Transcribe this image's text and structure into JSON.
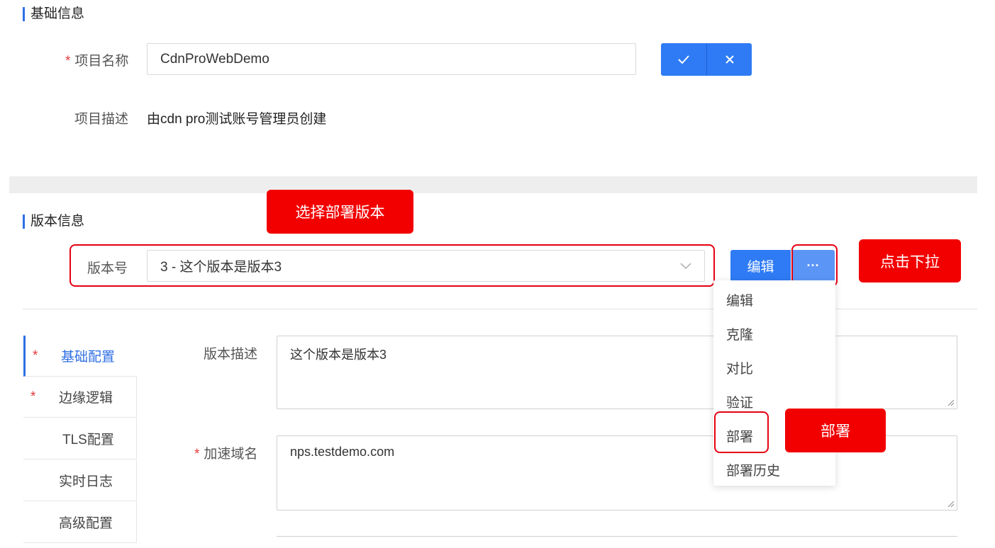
{
  "basic_info": {
    "title": "基础信息",
    "project_name_label": "项目名称",
    "project_name_value": "CdnProWebDemo",
    "confirm_icon": "check-icon",
    "cancel_icon": "close-icon",
    "project_desc_label": "项目描述",
    "project_desc_value": "由cdn pro测试账号管理员创建"
  },
  "version_info": {
    "title": "版本信息",
    "version_label": "版本号",
    "version_selected": "3 - 这个版本是版本3",
    "edit_button": "编辑",
    "more_button": "···"
  },
  "sidebar": {
    "tabs": [
      {
        "label": "基础配置",
        "required": "*"
      },
      {
        "label": "边缘逻辑",
        "required": "*"
      },
      {
        "label": "TLS配置",
        "required": ""
      },
      {
        "label": "实时日志",
        "required": ""
      },
      {
        "label": "高级配置",
        "required": ""
      }
    ]
  },
  "form": {
    "version_desc_label": "版本描述",
    "version_desc_value": "这个版本是版本3",
    "domain_label": "加速域名",
    "domain_value": "nps.testdemo.com"
  },
  "dropdown_menu": {
    "items": [
      "编辑",
      "克隆",
      "对比",
      "验证",
      "部署",
      "部署历史"
    ]
  },
  "annotations": {
    "select_version": "选择部署版本",
    "click_dropdown": "点击下拉",
    "deploy": "部署"
  },
  "colors": {
    "primary": "#2f7bf5",
    "annotation_red": "#f20000",
    "required_star": "#e4393c"
  }
}
